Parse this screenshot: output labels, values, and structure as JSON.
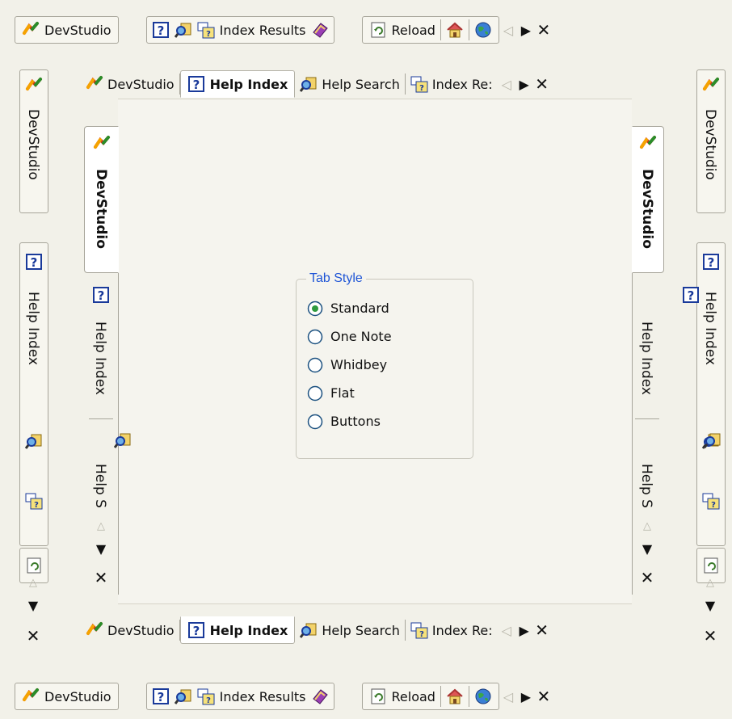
{
  "top_bar": {
    "devstudio_label": "DevStudio",
    "index_results_label": "Index Results",
    "reload_label": "Reload"
  },
  "doc_tabs_top": {
    "devstudio_label": "DevStudio",
    "help_index_label": "Help Index",
    "help_search_label": "Help Search",
    "index_results_label": "Index Re:"
  },
  "doc_tabs_bottom": {
    "devstudio_label": "DevStudio",
    "help_index_label": "Help Index",
    "help_search_label": "Help Search",
    "index_results_label": "Index Re:"
  },
  "bottom_bar": {
    "devstudio_label": "DevStudio",
    "index_results_label": "Index Results",
    "reload_label": "Reload"
  },
  "left_outer": {
    "devstudio_label": "DevStudio",
    "help_index_label": "Help Index"
  },
  "right_outer": {
    "devstudio_label": "DevStudio",
    "help_index_label": "Help Index"
  },
  "left_inner": {
    "devstudio_label": "DevStudio",
    "help_index_label": "Help Index",
    "help_search_label": "Help S"
  },
  "right_inner": {
    "devstudio_label": "DevStudio",
    "help_index_label": "Help Index",
    "help_search_label": "Help S"
  },
  "tab_style": {
    "legend": "Tab Style",
    "selected": "Standard",
    "options": [
      "Standard",
      "One Note",
      "Whidbey",
      "Flat",
      "Buttons"
    ]
  },
  "colors": {
    "legend_blue": "#1f55d6",
    "radio_green": "#2e9a3e",
    "border_gray": "#a7a59a",
    "background": "#f2f1e9"
  },
  "icons": [
    "devstudio-icon",
    "help-index-icon",
    "help-search-icon",
    "index-results-icon",
    "book-icon",
    "reload-icon",
    "home-icon",
    "globe-icon"
  ]
}
